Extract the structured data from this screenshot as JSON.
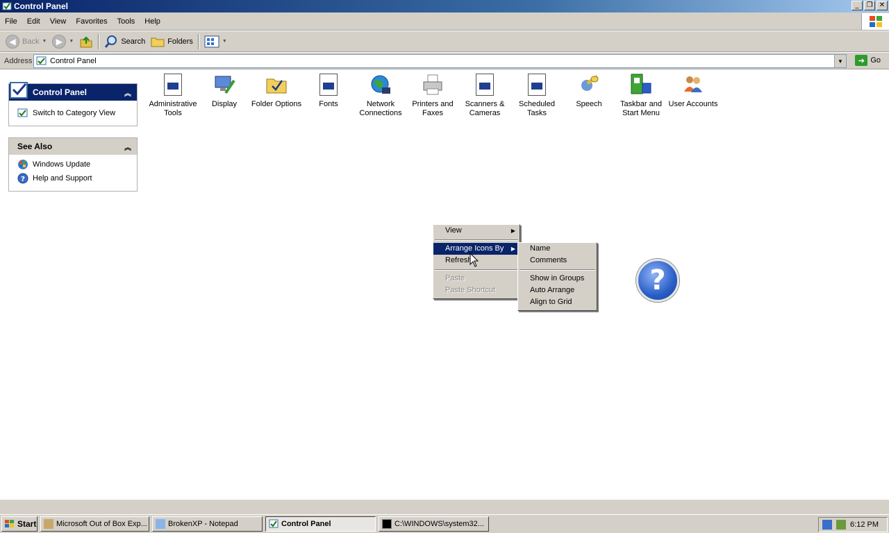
{
  "window": {
    "title": "Control Panel",
    "buttons": {
      "minimize": "_",
      "maximize": "❐",
      "close": "✕"
    }
  },
  "menubar": [
    "File",
    "Edit",
    "View",
    "Favorites",
    "Tools",
    "Help"
  ],
  "toolbar": {
    "back": "Back",
    "search": "Search",
    "folders": "Folders"
  },
  "address": {
    "label": "Address",
    "value": "Control Panel",
    "go": "Go"
  },
  "left_panes": {
    "control_panel": {
      "title": "Control Panel",
      "items": [
        "Switch to Category View"
      ]
    },
    "see_also": {
      "title": "See Also",
      "items": [
        "Windows Update",
        "Help and Support"
      ]
    }
  },
  "icons": [
    {
      "line1": "Administrative",
      "line2": "Tools"
    },
    {
      "line1": "Display",
      "line2": ""
    },
    {
      "line1": "Folder Options",
      "line2": ""
    },
    {
      "line1": "Fonts",
      "line2": ""
    },
    {
      "line1": "Network",
      "line2": "Connections"
    },
    {
      "line1": "Printers and",
      "line2": "Faxes"
    },
    {
      "line1": "Scanners &",
      "line2": "Cameras"
    },
    {
      "line1": "Scheduled",
      "line2": "Tasks"
    },
    {
      "line1": "Speech",
      "line2": ""
    },
    {
      "line1": "Taskbar and",
      "line2": "Start Menu"
    },
    {
      "line1": "User Accounts",
      "line2": ""
    }
  ],
  "context_menu": {
    "items": [
      "View",
      "Arrange Icons By",
      "Refresh",
      "Paste",
      "Paste Shortcut"
    ]
  },
  "submenu": {
    "items": [
      "Name",
      "Comments",
      "Show in Groups",
      "Auto Arrange",
      "Align to Grid"
    ]
  },
  "help_icon": {
    "glyph": "?"
  },
  "taskbar": {
    "start": "Start",
    "buttons": [
      "Microsoft Out of Box Exp...",
      "BrokenXP - Notepad",
      "Control Panel",
      "C:\\WINDOWS\\system32..."
    ],
    "clock": "6:12 PM"
  },
  "colors": {
    "titlebar": "#0a246a",
    "highlight": "#0a246a",
    "face": "#d4d0c8"
  }
}
